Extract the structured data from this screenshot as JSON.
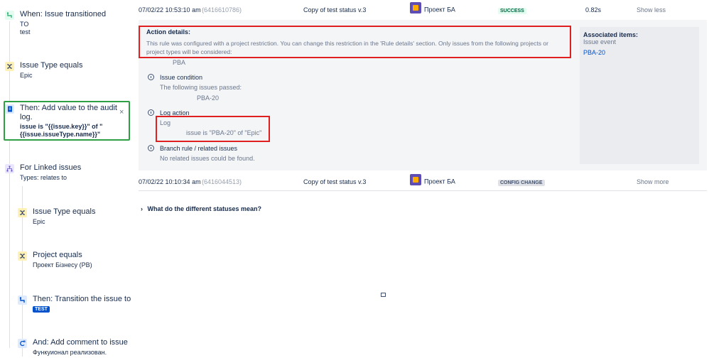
{
  "rule": {
    "trigger": {
      "title": "When: Issue transitioned",
      "line2": "TO",
      "line3": "test"
    },
    "cond1": {
      "title": "Issue Type equals",
      "sub": "Epic"
    },
    "action_audit": {
      "title_line1": "Then: Add value to the audit",
      "title_line2": "log.",
      "bold_line1": "issue is \"{{issue.key}}\" of \"",
      "bold_line2": "{{issue.issueType.name}}\"",
      "close": "×"
    },
    "branch": {
      "title": "For Linked issues",
      "sub": "Types: relates to"
    },
    "cond2": {
      "title": "Issue Type equals",
      "sub": "Epic"
    },
    "cond3": {
      "title": "Project equals",
      "sub": "Проект Бізнесу (PB)"
    },
    "transition": {
      "title": "Then: Transition the issue to",
      "badge": "TEST"
    },
    "comment": {
      "title": "And: Add comment to issue",
      "sub": "Функуионал реализован."
    }
  },
  "rows": [
    {
      "date": "07/02/22 10:53:10 am",
      "id": "(6416610786)",
      "rule": "Copy of test status v.3",
      "project": "Проект БА",
      "status": "SUCCESS",
      "duration": "0.82s",
      "toggle": "Show less"
    },
    {
      "date": "07/02/22 10:10:34 am",
      "id": "(6416044513)",
      "rule": "Copy of test status v.3",
      "project": "Проект БА",
      "status": "CONFIG CHANGE",
      "duration": "",
      "toggle": "Show more"
    }
  ],
  "details": {
    "heading": "Action details:",
    "restriction_line1": "This rule was configured with a project restriction. You can change this restriction in the 'Rule details' section. Only issues from the following projects or",
    "restriction_line2": "project types will be considered:",
    "project_code": "PBA",
    "issue_condition": {
      "title": "Issue condition",
      "line": "The following issues passed:",
      "key": "PBA-20"
    },
    "log_action": {
      "title": "Log action",
      "label": "Log",
      "message": "issue is \"PBA-20\" of \"Epic\""
    },
    "branch_rule": {
      "title": "Branch rule / related issues",
      "line": "No related issues could be found."
    },
    "associated": {
      "heading": "Associated items:",
      "sub": "Issue event",
      "link": "PBA-20"
    }
  },
  "faq": "What do the different statuses mean?",
  "colors": {
    "success_bg": "#e3fcef",
    "highlight_red": "#e02020",
    "highlight_green": "#2ea043",
    "brand_blue": "#0052cc"
  }
}
